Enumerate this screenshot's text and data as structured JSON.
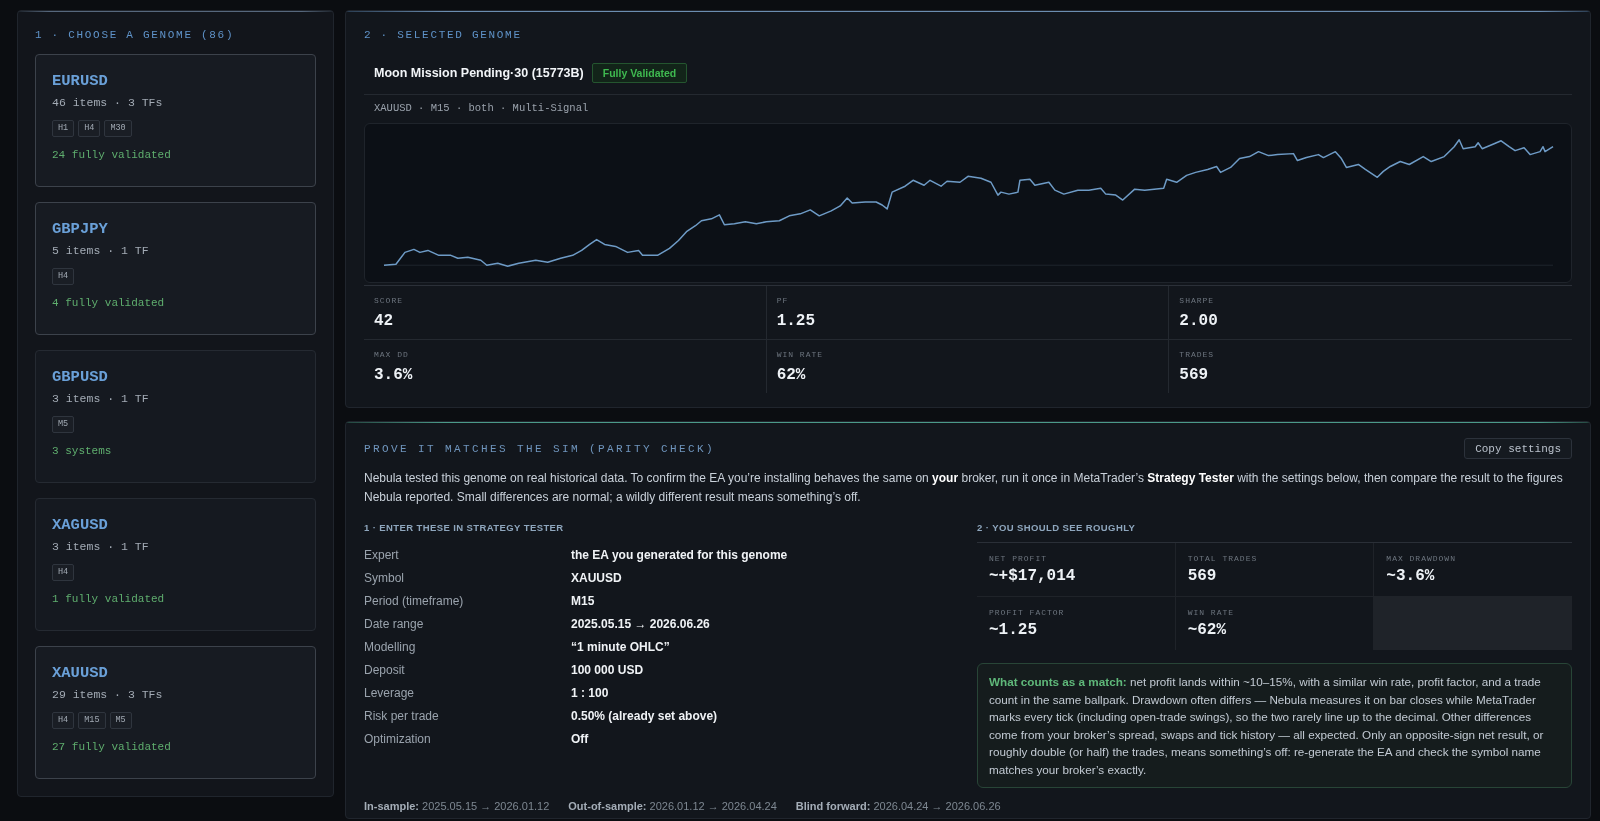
{
  "genome_list": {
    "title": "1 · CHOOSE A GENOME (86)",
    "cards": [
      {
        "symbol": "EURUSD",
        "summary": "46 items · 3 TFs",
        "timeframes": [
          "H1",
          "H4",
          "M30"
        ],
        "status": "24 fully validated",
        "highlighted": true
      },
      {
        "symbol": "GBPJPY",
        "summary": "5 items · 1 TF",
        "timeframes": [
          "H4"
        ],
        "status": "4 fully validated",
        "highlighted": true
      },
      {
        "symbol": "GBPUSD",
        "summary": "3 items · 1 TF",
        "timeframes": [
          "M5"
        ],
        "status": "3 systems",
        "highlighted": false
      },
      {
        "symbol": "XAGUSD",
        "summary": "3 items · 1 TF",
        "timeframes": [
          "H4"
        ],
        "status": "1 fully validated",
        "highlighted": false
      },
      {
        "symbol": "XAUUSD",
        "summary": "29 items · 3 TFs",
        "timeframes": [
          "H4",
          "M15",
          "M5"
        ],
        "status": "27 fully validated",
        "highlighted": true
      }
    ]
  },
  "selected_genome": {
    "title": "2 · SELECTED GENOME",
    "name": "Moon Mission Pending·30 (15773B)",
    "badge": "Fully Validated",
    "meta": "XAUUSD · M15 · both · Multi-Signal",
    "stats": [
      {
        "label": "SCORE",
        "value": "42"
      },
      {
        "label": "PF",
        "value": "1.25"
      },
      {
        "label": "SHARPE",
        "value": "2.00"
      },
      {
        "label": "MAX DD",
        "value": "3.6%"
      },
      {
        "label": "WIN RATE",
        "value": "62%"
      },
      {
        "label": "TRADES",
        "value": "569"
      }
    ]
  },
  "parity_check": {
    "title": "PROVE IT MATCHES THE SIM (PARITY CHECK)",
    "copy_button": "Copy settings",
    "intro": "Nebula tested this genome on real historical data. To confirm the EA you’re installing behaves the same on **your** broker, run it once in MetaTrader’s **Strategy Tester** with the settings below, then compare the result to the figures Nebula reported. Small differences are normal; a wildly different result means something’s off.",
    "settings": {
      "heading": "1 · ENTER THESE IN STRATEGY TESTER",
      "rows": [
        {
          "label": "Expert",
          "value": "the EA you generated for this genome"
        },
        {
          "label": "Symbol",
          "value": "XAUUSD"
        },
        {
          "label": "Period (timeframe)",
          "value": "M15"
        },
        {
          "label": "Date range",
          "value": "2025.05.15 → 2026.06.26"
        },
        {
          "label": "Modelling",
          "value": "“1 minute OHLC”"
        },
        {
          "label": "Deposit",
          "value": "100 000 USD"
        },
        {
          "label": "Leverage",
          "value": "1 : 100"
        },
        {
          "label": "Risk per trade",
          "value": "0.50% (already set above)"
        },
        {
          "label": "Optimization",
          "value": "Off"
        }
      ]
    },
    "expected": {
      "heading": "2 · YOU SHOULD SEE ROUGHLY",
      "metrics": [
        {
          "label": "NET PROFIT",
          "value": "~+$17,014"
        },
        {
          "label": "TOTAL TRADES",
          "value": "569"
        },
        {
          "label": "MAX DRAWDOWN",
          "value": "~3.6%"
        },
        {
          "label": "PROFIT FACTOR",
          "value": "~1.25"
        },
        {
          "label": "WIN RATE",
          "value": "~62%"
        }
      ]
    },
    "note": "**What counts as a match:** net profit lands within ~10–15%, with a similar win rate, profit factor, and a trade count in the same ballpark. Drawdown often differs — Nebula measures it on bar closes while MetaTrader marks every tick (including open-trade swings), so the two rarely line up to the decimal. Other differences come from your broker’s spread, swaps and tick history — all expected. Only an opposite-sign net result, or roughly double (or half) the trades, means something’s off: re-generate the EA and check the symbol name matches your broker’s exactly.",
    "windows": [
      "**In-sample:** 2025.05.15 → 2026.01.12",
      "**Out-of-sample:** 2026.01.12 → 2026.04.24",
      "**Blind forward:** 2026.04.24 → 2026.06.26"
    ]
  }
}
